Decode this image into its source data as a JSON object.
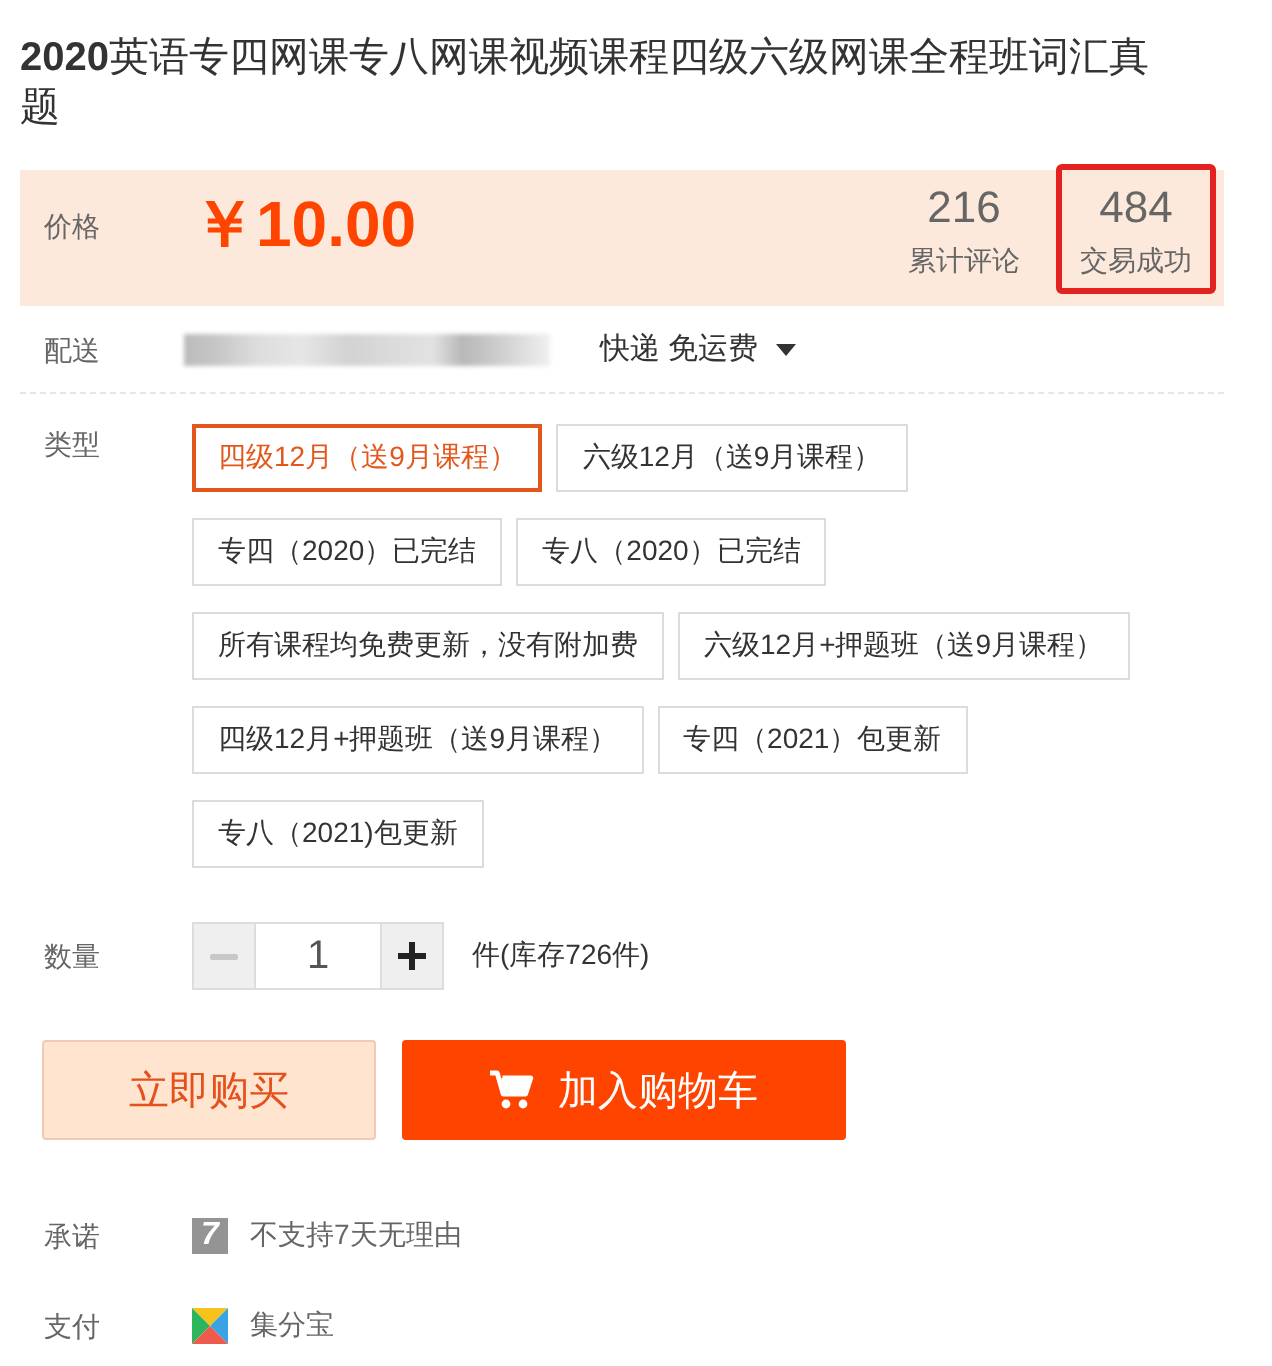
{
  "title": "**2020**英语专四网课专八网课视频课程四级六级网课全程班词汇真题",
  "price": {
    "label": "价格",
    "amount": "￥10.00"
  },
  "stats": [
    {
      "value": "216",
      "label": "累计评论",
      "highlighted": false
    },
    {
      "value": "484",
      "label": "交易成功",
      "highlighted": true
    }
  ],
  "delivery": {
    "label": "配送",
    "shipping": "快递 免运费"
  },
  "type": {
    "label": "类型",
    "options": [
      {
        "label": "四级12月（送9月课程）",
        "selected": true
      },
      {
        "label": "六级12月（送9月课程）",
        "selected": false
      },
      {
        "label": "专四（2020）已完结",
        "selected": false
      },
      {
        "label": "专八（2020）已完结",
        "selected": false
      },
      {
        "label": "所有课程均免费更新，没有附加费",
        "selected": false
      },
      {
        "label": "六级12月+押题班（送9月课程）",
        "selected": false
      },
      {
        "label": "四级12月+押题班（送9月课程）",
        "selected": false
      },
      {
        "label": "专四（2021）包更新",
        "selected": false
      },
      {
        "label": "专八（2021)包更新",
        "selected": false
      }
    ]
  },
  "quantity": {
    "label": "数量",
    "value": "1",
    "decrease_disabled": true,
    "stock": "件(库存726件)"
  },
  "actions": [
    {
      "kind": "buy",
      "label": "立即购买"
    },
    {
      "kind": "cart",
      "label": "加入购物车"
    }
  ],
  "promise": {
    "label": "承诺",
    "badge": "7",
    "text": "不支持7天无理由"
  },
  "payment": {
    "label": "支付",
    "text": "集分宝"
  }
}
